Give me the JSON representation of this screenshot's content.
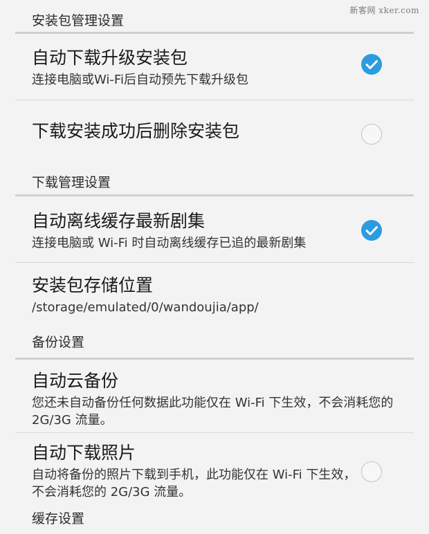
{
  "watermark": "新客网 xker.com",
  "sections": {
    "install": {
      "header": "安装包管理设置",
      "auto_download": {
        "title": "自动下载升级安装包",
        "summary": "连接电脑或Wi-Fi后自动预先下载升级包",
        "checked": true
      },
      "delete_after": {
        "title": "下载安装成功后删除安装包",
        "checked": false
      }
    },
    "download": {
      "header": "下载管理设置",
      "offline_cache": {
        "title": "自动离线缓存最新剧集",
        "summary": "连接电脑或 Wi-Fi 时自动离线缓存已追的最新剧集",
        "checked": true
      },
      "storage_location": {
        "title": "安装包存储位置",
        "summary": "/storage/emulated/0/wandoujia/app/"
      }
    },
    "backup": {
      "header": "备份设置",
      "cloud_backup": {
        "title": "自动云备份",
        "summary": "您还未自动备份任何数据此功能仅在 Wi-Fi 下生效，不会消耗您的 2G/3G 流量。"
      },
      "photo_download": {
        "title": "自动下载照片",
        "summary": "自动将备份的照片下载到手机，此功能仅在 Wi-Fi 下生效，不会消耗您的 2G/3G 流量。",
        "checked": false
      }
    },
    "cache": {
      "header": "缓存设置"
    }
  },
  "colors": {
    "accent": "#2b9ce0",
    "background": "#f3f3f3",
    "divider": "#cfcfcf"
  },
  "icons": {
    "checked": "check-circle-icon",
    "unchecked": "empty-circle-icon"
  }
}
